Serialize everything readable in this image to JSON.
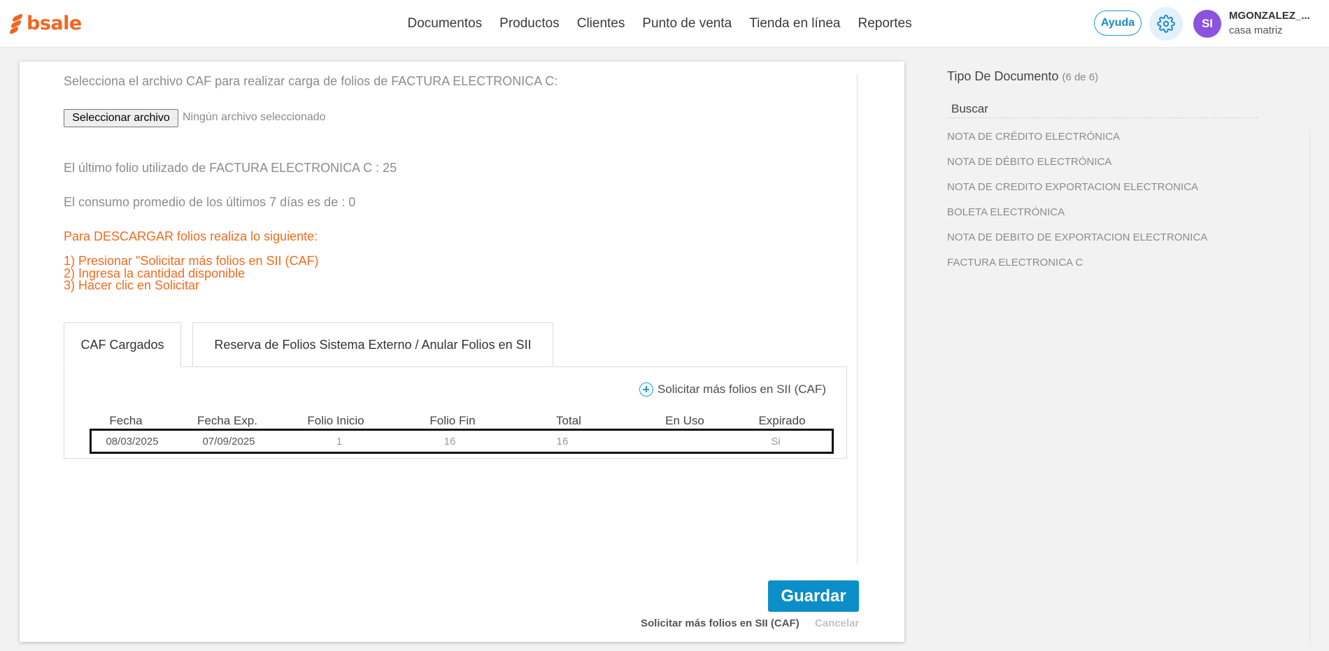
{
  "brand": {
    "logo_text": "bsale",
    "accent": "#f26522"
  },
  "nav": {
    "items": [
      "Documentos",
      "Productos",
      "Clientes",
      "Punto de venta",
      "Tienda en línea",
      "Reportes"
    ]
  },
  "header": {
    "help_label": "Ayuda",
    "settings_icon": "gear-icon",
    "avatar_initials": "SI",
    "avatar_color": "#8c52e0",
    "user_name": "MGONZALEZ_...",
    "user_branch": "casa matriz"
  },
  "upload": {
    "instruction": "Selecciona el archivo CAF para realizar carga de folios de FACTURA ELECTRONICA C:",
    "file_button": "Seleccionar archivo",
    "file_status": "Ningún archivo seleccionado"
  },
  "info": {
    "last_folio": "El último folio utilizado de FACTURA ELECTRONICA C : 25",
    "avg_consumption": "El consumo promedio de los últimos 7 días es de : 0"
  },
  "steps": {
    "title": "Para DESCARGAR folios realiza lo siguiente:",
    "items": [
      "1) Presionar \"Solicitar más folios en SII (CAF)",
      "2) Ingresa la cantidad disponible",
      "3) Hacer clic en Solicitar"
    ]
  },
  "tabs": [
    {
      "label": "CAF Cargados",
      "active": true
    },
    {
      "label": "Reserva de Folios Sistema Externo / Anular Folios en SII",
      "active": false
    }
  ],
  "caf_table": {
    "request_link": "Solicitar más folios en SII (CAF)",
    "columns": [
      "Fecha",
      "Fecha Exp.",
      "Folio Inicio",
      "Folio Fin",
      "Total",
      "En Uso",
      "Expirado"
    ],
    "rows": [
      {
        "fecha": "08/03/2025",
        "fecha_exp": "07/09/2025",
        "folio_inicio": "1",
        "folio_fin": "16",
        "total": "16",
        "en_uso": "",
        "expirado": "Si"
      }
    ]
  },
  "actions": {
    "save": "Guardar",
    "request_more": "Solicitar más folios en SII (CAF)",
    "cancel": "Cancelar"
  },
  "sidebar": {
    "title": "Tipo De Documento",
    "count": "(6 de 6)",
    "search_placeholder": "Buscar",
    "items": [
      "NOTA DE CRÉDITO ELECTRÓNICA",
      "NOTA DE DÉBITO ELECTRÓNICA",
      "NOTA DE CREDITO EXPORTACION ELECTRONICA",
      "BOLETA ELECTRÓNICA",
      "NOTA DE DEBITO DE EXPORTACION ELECTRONICA",
      "FACTURA ELECTRONICA C"
    ]
  }
}
